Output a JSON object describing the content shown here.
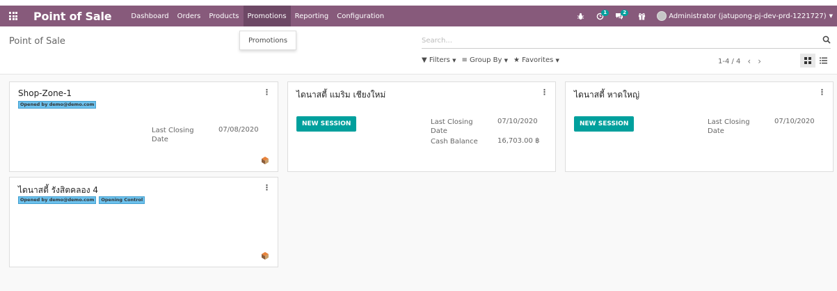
{
  "navbar": {
    "app_title": "Point of Sale",
    "menu": [
      "Dashboard",
      "Orders",
      "Products",
      "Promotions",
      "Reporting",
      "Configuration"
    ],
    "active_menu": "Promotions",
    "activity_badge": "1",
    "messages_badge": "2",
    "user": "Administrator (jatupong-pj-dev-prd-1221727)"
  },
  "dropdown": {
    "item": "Promotions"
  },
  "control_panel": {
    "breadcrumb": "Point of Sale",
    "search_placeholder": "Search...",
    "filters": "Filters",
    "group_by": "Group By",
    "favorites": "Favorites",
    "pager": "1-4 / 4"
  },
  "cards": [
    {
      "title": "Shop-Zone-1",
      "tags": [
        "Opened by demo@demo.com"
      ],
      "closing_label": "Last Closing Date",
      "closing_value": "07/08/2020"
    },
    {
      "title": "ไดนาสตี้ แมริม เชียงใหม่",
      "button": "NEW SESSION",
      "closing_label": "Last Closing Date",
      "closing_value": "07/10/2020",
      "cash_label": "Cash Balance",
      "cash_value": "16,703.00 ฿"
    },
    {
      "title": "ไดนาสตี้ หาดใหญ่",
      "button": "NEW SESSION",
      "closing_label": "Last Closing Date",
      "closing_value": "07/10/2020"
    },
    {
      "title": "ไดนาสตี้ รังสิตคลอง 4",
      "tags": [
        "Opened by demo@demo.com",
        "Opening Control"
      ]
    }
  ],
  "colors": {
    "navbar": "#875a7b",
    "primary_button": "#00a09d",
    "tag": "#6cc1ed"
  }
}
